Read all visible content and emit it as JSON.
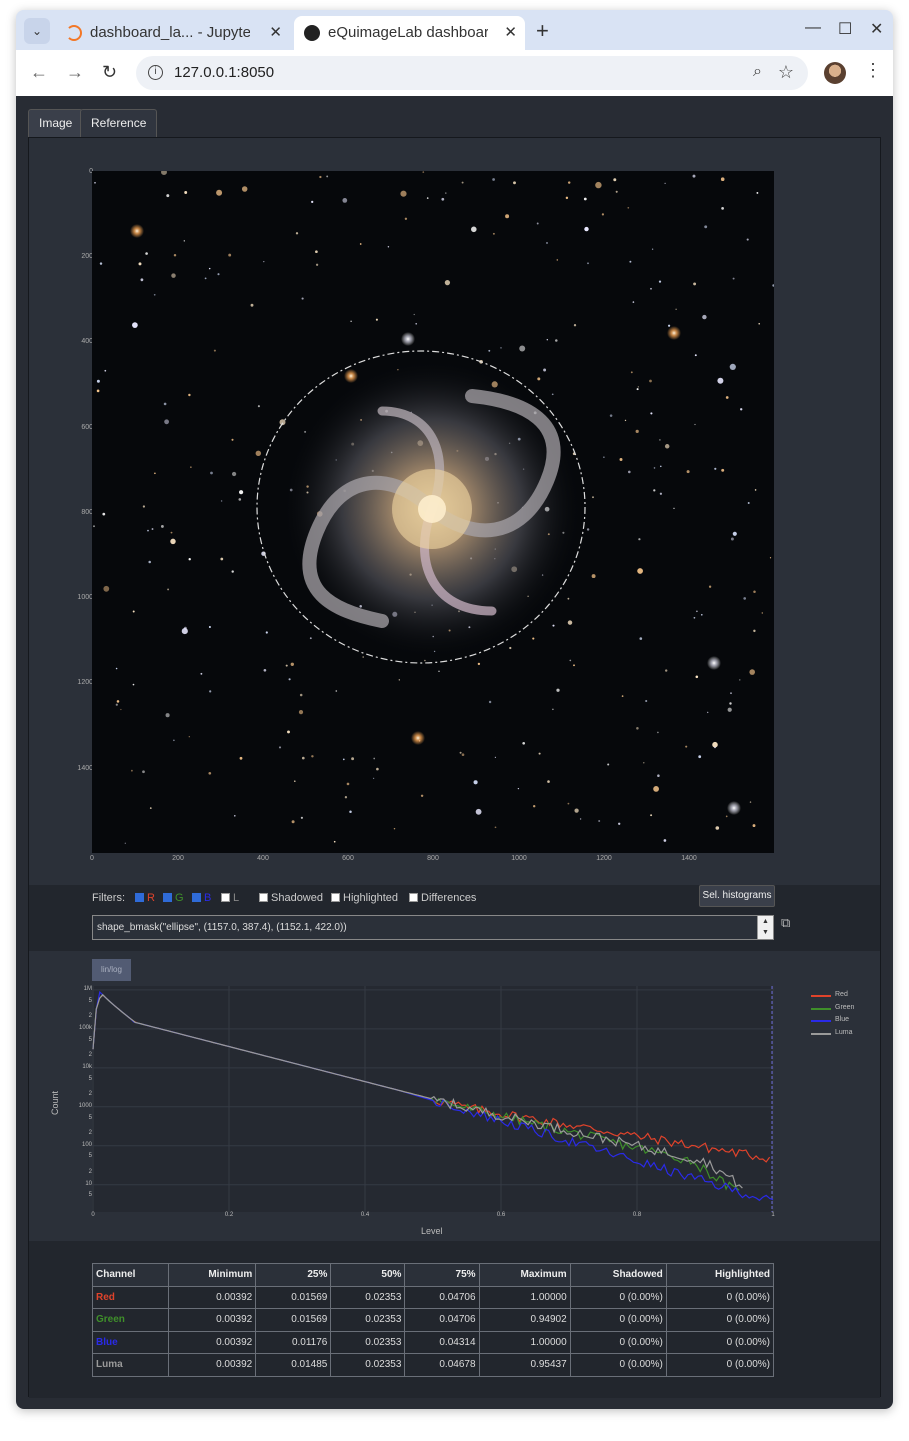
{
  "browser": {
    "tabs": [
      {
        "title": "dashboard_la... - Jupyter",
        "close": "✕"
      },
      {
        "title": "eQuimageLab dashboard",
        "close": "✕"
      }
    ],
    "new_tab": "+",
    "url": "127.0.0.1:8050",
    "window_controls": {
      "minimize": "—",
      "maximize": "☐",
      "close": "✕"
    }
  },
  "app": {
    "tabs": [
      {
        "label": "Image"
      },
      {
        "label": "Reference"
      }
    ],
    "image_axes": {
      "y_ticks": [
        "0",
        "200",
        "400",
        "600",
        "800",
        "1000",
        "1200",
        "1400"
      ],
      "x_ticks": [
        "0",
        "200",
        "400",
        "600",
        "800",
        "1000",
        "1200",
        "1400"
      ]
    },
    "filters": {
      "label": "Filters:",
      "R": "R",
      "G": "G",
      "B": "B",
      "L": "L",
      "shadowed": "Shadowed",
      "highlighted": "Highlighted",
      "differences": "Differences",
      "sel_histograms": "Sel. histograms",
      "shape_value": "shape_bmask(\"ellipse\", (1157.0, 387.4), (1152.1, 422.0))"
    },
    "histogram": {
      "toggle": "lin/log",
      "ylabel": "Count",
      "xlabel": "Level",
      "y_ticks": [
        "1M",
        "5",
        "2",
        "100k",
        "5",
        "2",
        "10k",
        "5",
        "2",
        "1000",
        "5",
        "2",
        "100",
        "5",
        "2",
        "10",
        "5"
      ],
      "x_ticks": [
        "0",
        "0.2",
        "0.4",
        "0.6",
        "0.8",
        "1"
      ],
      "legend": [
        "Red",
        "Green",
        "Blue",
        "Luma"
      ],
      "colors": {
        "Red": "#e0432b",
        "Green": "#3f8f2a",
        "Blue": "#2a2ae8",
        "Luma": "#9a9a9a"
      }
    },
    "stats": {
      "headers": [
        "Channel",
        "Minimum",
        "25%",
        "50%",
        "75%",
        "Maximum",
        "Shadowed",
        "Highlighted"
      ],
      "rows": [
        {
          "channel": "Red",
          "min": "0.00392",
          "p25": "0.01569",
          "p50": "0.02353",
          "p75": "0.04706",
          "max": "1.00000",
          "shadowed": "0 (0.00%)",
          "highlighted": "0 (0.00%)"
        },
        {
          "channel": "Green",
          "min": "0.00392",
          "p25": "0.01569",
          "p50": "0.02353",
          "p75": "0.04706",
          "max": "0.94902",
          "shadowed": "0 (0.00%)",
          "highlighted": "0 (0.00%)"
        },
        {
          "channel": "Blue",
          "min": "0.00392",
          "p25": "0.01176",
          "p50": "0.02353",
          "p75": "0.04314",
          "max": "1.00000",
          "shadowed": "0 (0.00%)",
          "highlighted": "0 (0.00%)"
        },
        {
          "channel": "Luma",
          "min": "0.00392",
          "p25": "0.01485",
          "p50": "0.02353",
          "p75": "0.04678",
          "max": "0.95437",
          "shadowed": "0 (0.00%)",
          "highlighted": "0 (0.00%)"
        }
      ]
    }
  }
}
